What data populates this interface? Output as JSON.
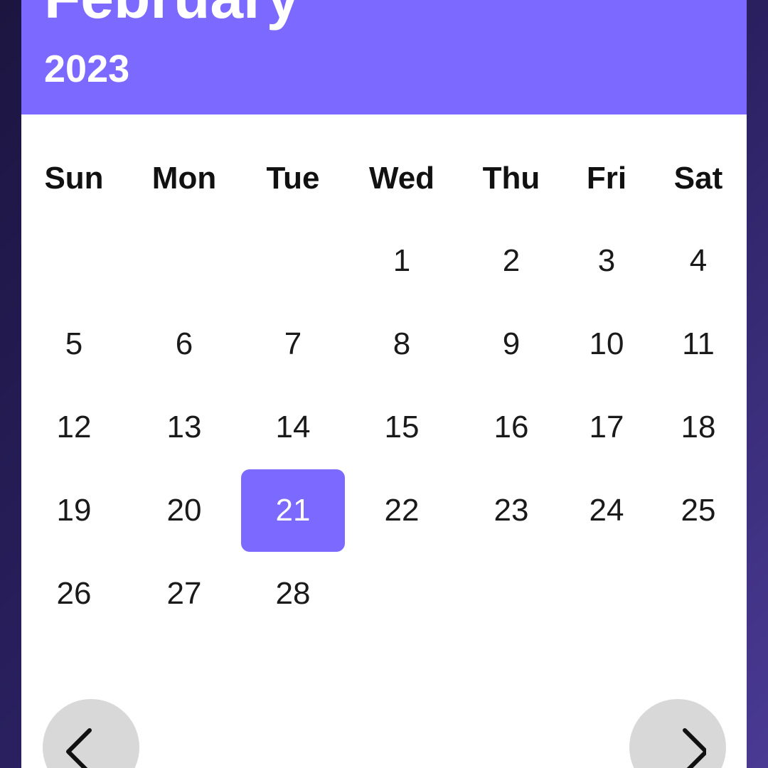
{
  "header": {
    "month": "February",
    "year": "2023"
  },
  "weekdays": [
    "Sun",
    "Mon",
    "Tue",
    "Wed",
    "Thu",
    "Fri",
    "Sat"
  ],
  "weeks": [
    [
      "",
      "",
      "",
      "1",
      "2",
      "3",
      "4"
    ],
    [
      "5",
      "6",
      "7",
      "8",
      "9",
      "10",
      "11"
    ],
    [
      "12",
      "13",
      "14",
      "15",
      "16",
      "17",
      "18"
    ],
    [
      "19",
      "20",
      "21",
      "22",
      "23",
      "24",
      "25"
    ],
    [
      "26",
      "27",
      "28",
      "",
      "",
      "",
      ""
    ]
  ],
  "selected_day": "21",
  "colors": {
    "accent": "#7c69ff",
    "nav_button": "#d8d8d8",
    "background_dark": "#1c1540",
    "background_light": "#4a3a94"
  },
  "icons": {
    "prev": "chevron-left-icon",
    "next": "chevron-right-icon"
  }
}
